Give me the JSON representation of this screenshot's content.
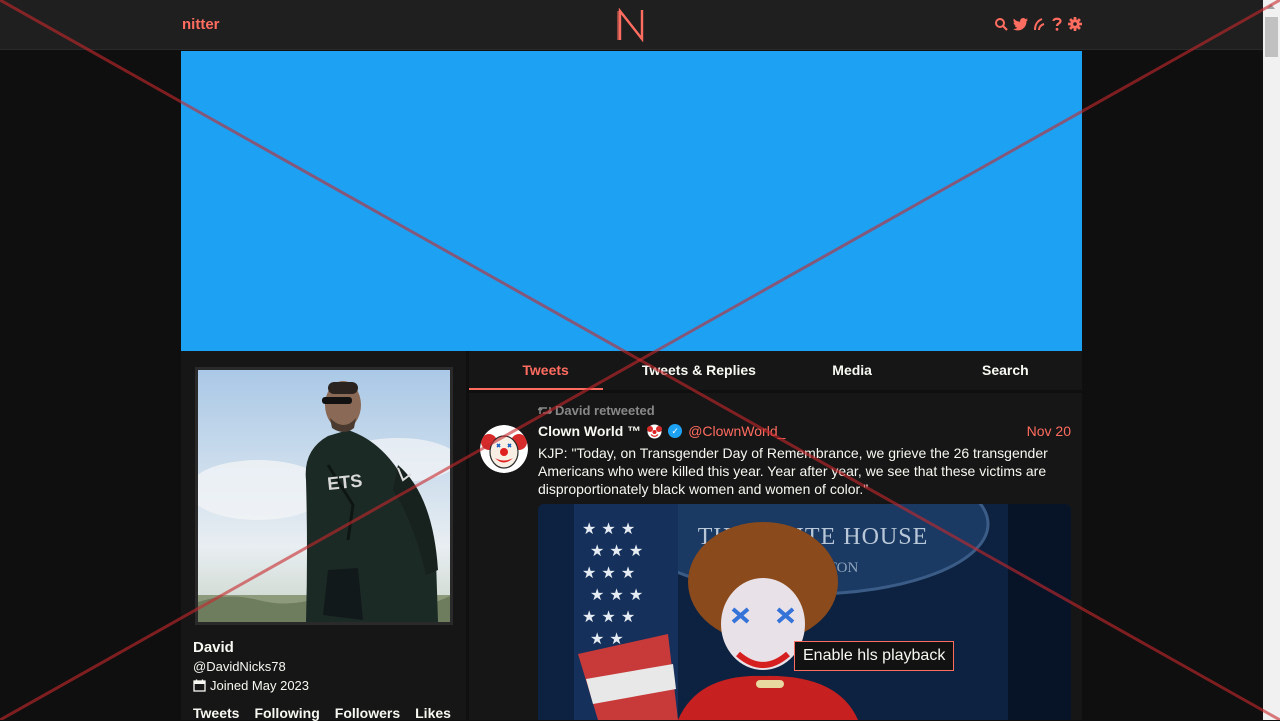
{
  "colors": {
    "accent": "#ff6c60",
    "banner": "#1da1f2",
    "background": "#0f0f0f",
    "panel": "#161616"
  },
  "navbar": {
    "brand": "nitter",
    "icons": [
      "search-icon",
      "twitter-bird-icon",
      "rss-icon",
      "help-icon",
      "gear-icon"
    ]
  },
  "profile": {
    "fullname": "David",
    "username": "@DavidNicks78",
    "joined": "Joined May 2023",
    "stats": {
      "tweets": "Tweets",
      "following": "Following",
      "followers": "Followers",
      "likes": "Likes"
    }
  },
  "tabs": [
    {
      "label": "Tweets",
      "active": true
    },
    {
      "label": "Tweets & Replies",
      "active": false
    },
    {
      "label": "Media",
      "active": false
    },
    {
      "label": "Search",
      "active": false
    }
  ],
  "tweet": {
    "retweet_header": "David retweeted",
    "fullname": "Clown World ™",
    "username": "@ClownWorld_",
    "date": "Nov 20",
    "text": "KJP: \"Today, on Transgender Day of Remembrance, we grieve the 26 transgender Americans who were killed this year. Year after year, we see that these victims are disproportionately black women and women of color.\"",
    "video_sign": "THE WHITE HOUSE",
    "video_sign_sub": "TON",
    "hls_button": "Enable hls playback"
  },
  "avatar_shirt_text": "ETS"
}
